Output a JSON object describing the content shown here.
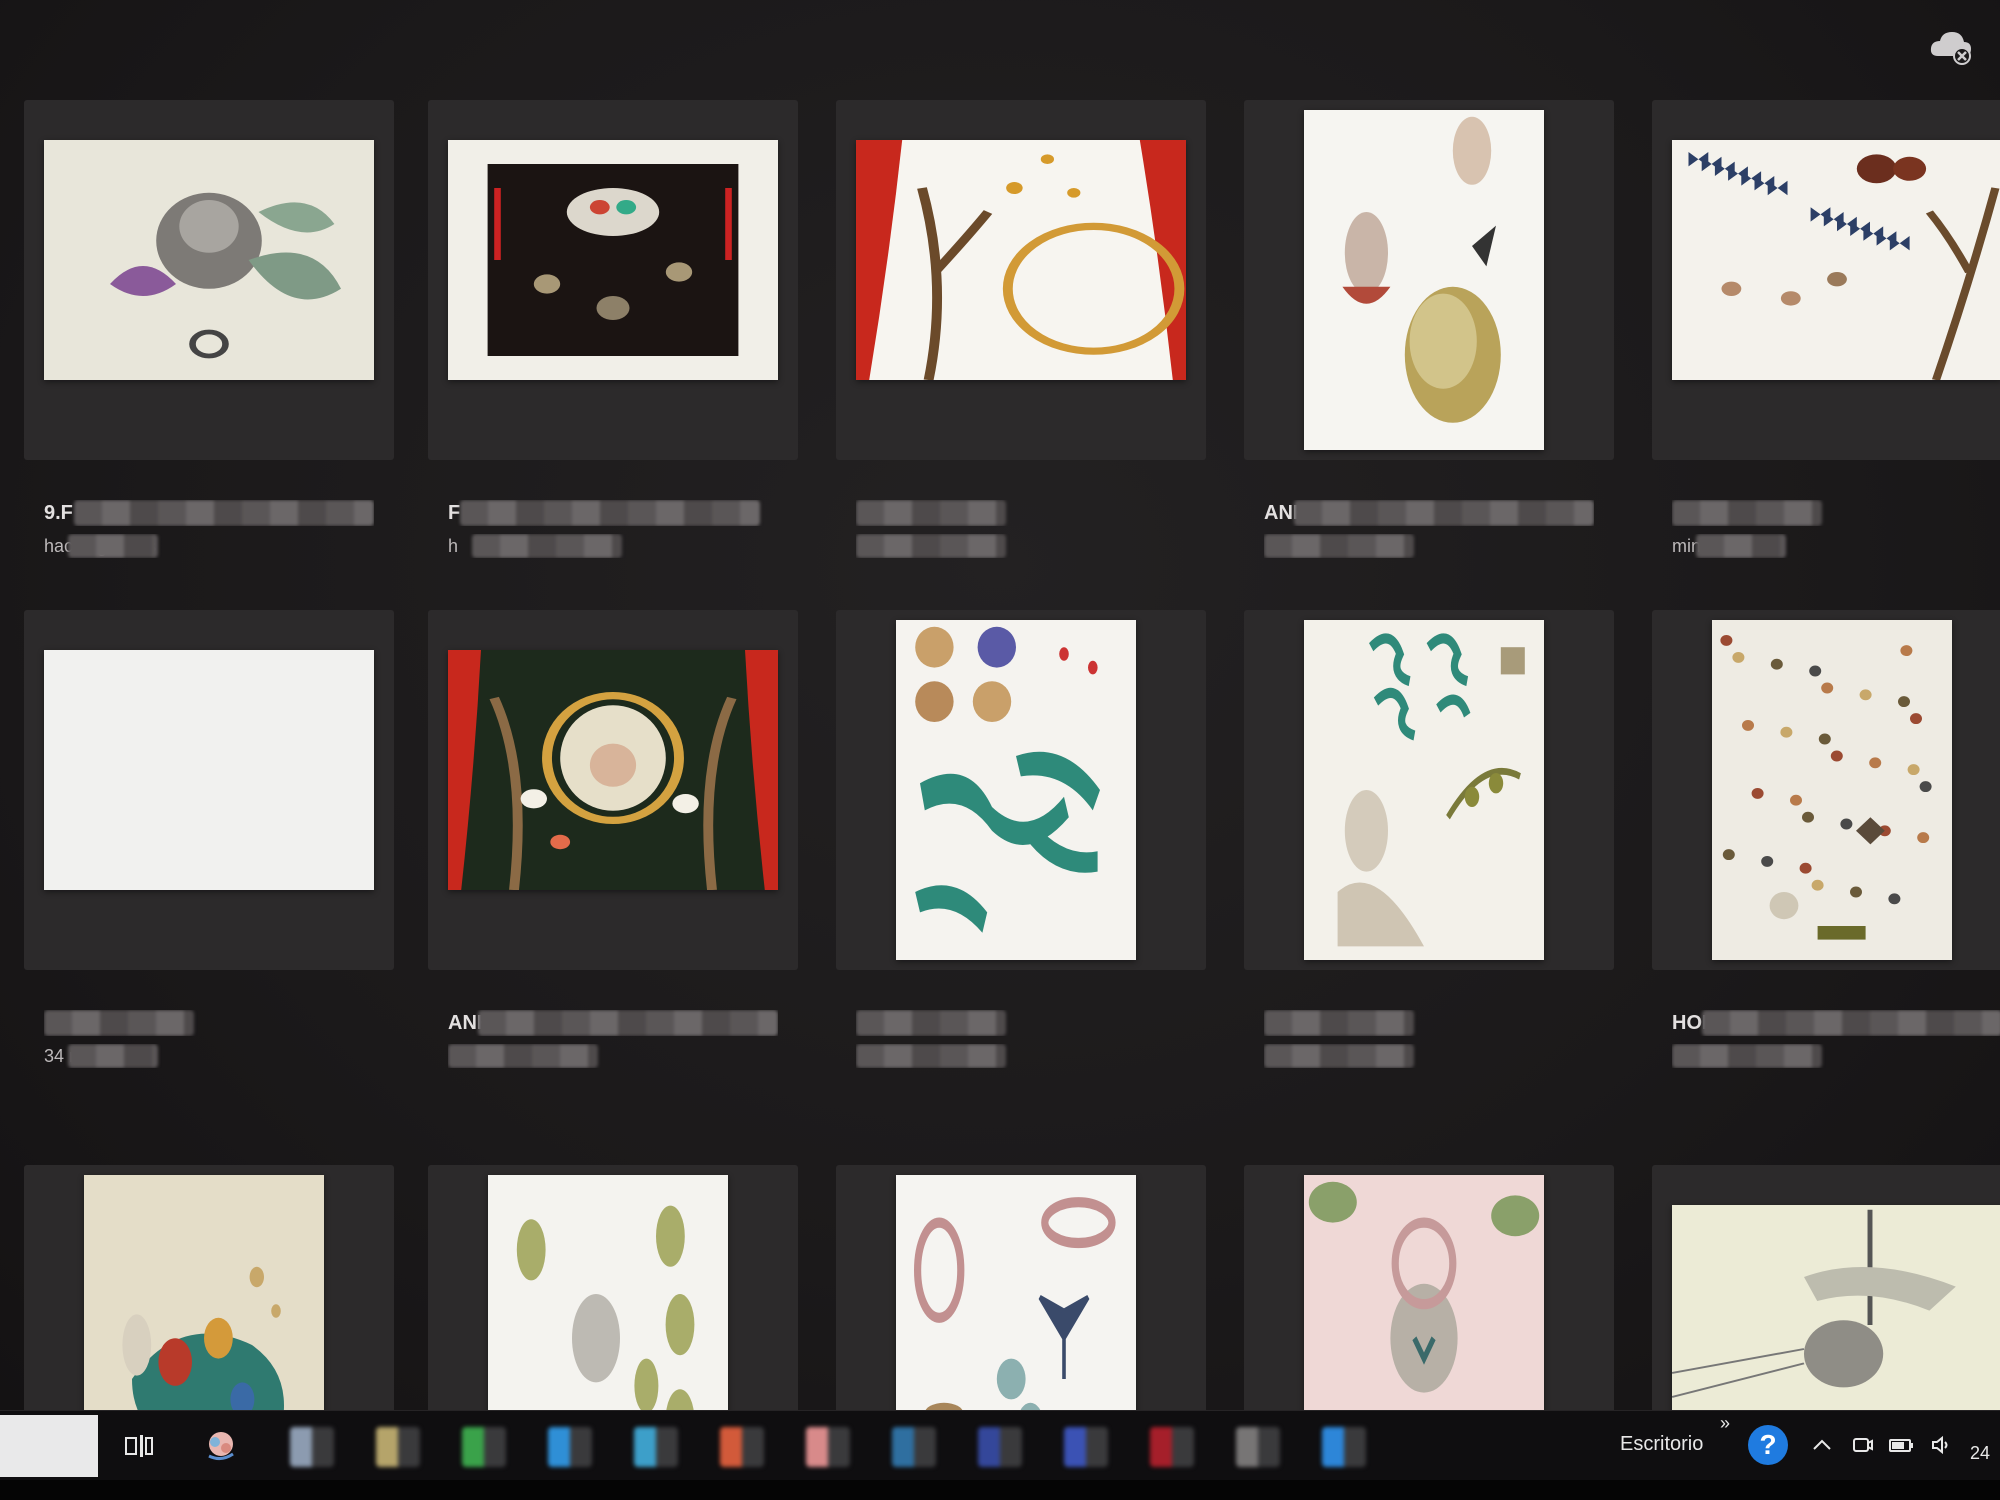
{
  "header": {
    "cloud_status_icon": "cloud-sync-error-icon"
  },
  "files": [
    {
      "name": "9.F",
      "time": "hac segundos",
      "art": "collage-woman-leaves",
      "orientation": "landscape"
    },
    {
      "name": "F",
      "time": "h",
      "art": "baroque-dark-frame",
      "orientation": "landscape"
    },
    {
      "name": "",
      "time": "",
      "art": "curtains-golden-ring",
      "orientation": "landscape"
    },
    {
      "name": "ANKLE",
      "time": "",
      "art": "sticker-sheet-bust-moon",
      "orientation": "portrait"
    },
    {
      "name": "",
      "time": "minutos",
      "art": "butterflies-branch",
      "orientation": "landscape"
    },
    {
      "name": "",
      "time": "34 minutos",
      "art": "blank-canvas",
      "orientation": "landscape"
    },
    {
      "name": "ANKLES VENTA VERAN",
      "time": "",
      "art": "framed-garden-scene",
      "orientation": "landscape"
    },
    {
      "name": "",
      "time": "",
      "art": "teal-waves-shells",
      "orientation": "portrait"
    },
    {
      "name": "",
      "time": "",
      "art": "teal-snakes-woman",
      "orientation": "portrait"
    },
    {
      "name": "HOME",
      "time": "",
      "art": "scattered-insects",
      "orientation": "portrait"
    },
    {
      "name": "",
      "time": "",
      "art": "floral-woman-collage",
      "orientation": "portrait"
    },
    {
      "name": "",
      "time": "",
      "art": "woman-with-leaves",
      "orientation": "portrait"
    },
    {
      "name": "",
      "time": "",
      "art": "jewelry-insects",
      "orientation": "portrait"
    },
    {
      "name": "",
      "time": "",
      "art": "pink-floral-portrait",
      "orientation": "portrait"
    },
    {
      "name": "",
      "time": "",
      "art": "ship-portrait",
      "orientation": "landscape"
    }
  ],
  "taskbar": {
    "desktop_label": "Escritorio",
    "overflow_glyph": "»",
    "help_glyph": "?",
    "clock_partial": "24",
    "tray_icons": [
      "chevron-up-icon",
      "meet-now-icon",
      "battery-icon",
      "speaker-icon"
    ],
    "pinned_colors": [
      "#8c9bb0",
      "#b5a46a",
      "#3aa24a",
      "#2f8fd6",
      "#3d9fc9",
      "#d25a3a",
      "#d88a8a",
      "#2f6fa0",
      "#34479a",
      "#3b52b4",
      "#a51f2a",
      "#777575",
      "#2d86d8"
    ]
  }
}
